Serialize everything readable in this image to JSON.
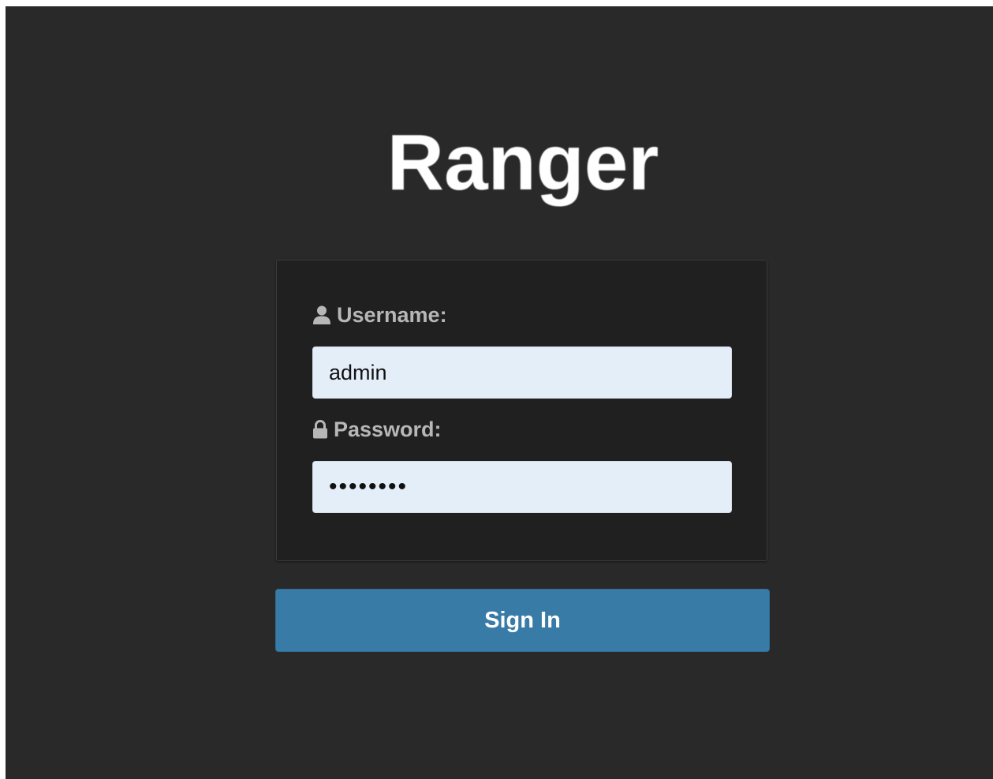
{
  "app": {
    "logo_text": "Ranger"
  },
  "login": {
    "username": {
      "label": "Username:",
      "value": "admin",
      "icon": "user-icon"
    },
    "password": {
      "label": "Password:",
      "value": "admin123",
      "icon": "lock-icon"
    },
    "submit_label": "Sign In"
  },
  "colors": {
    "background": "#292929",
    "panel": "#202020",
    "input_background": "#e4eef9",
    "button": "#387ba7",
    "label": "#b7b7b7"
  }
}
